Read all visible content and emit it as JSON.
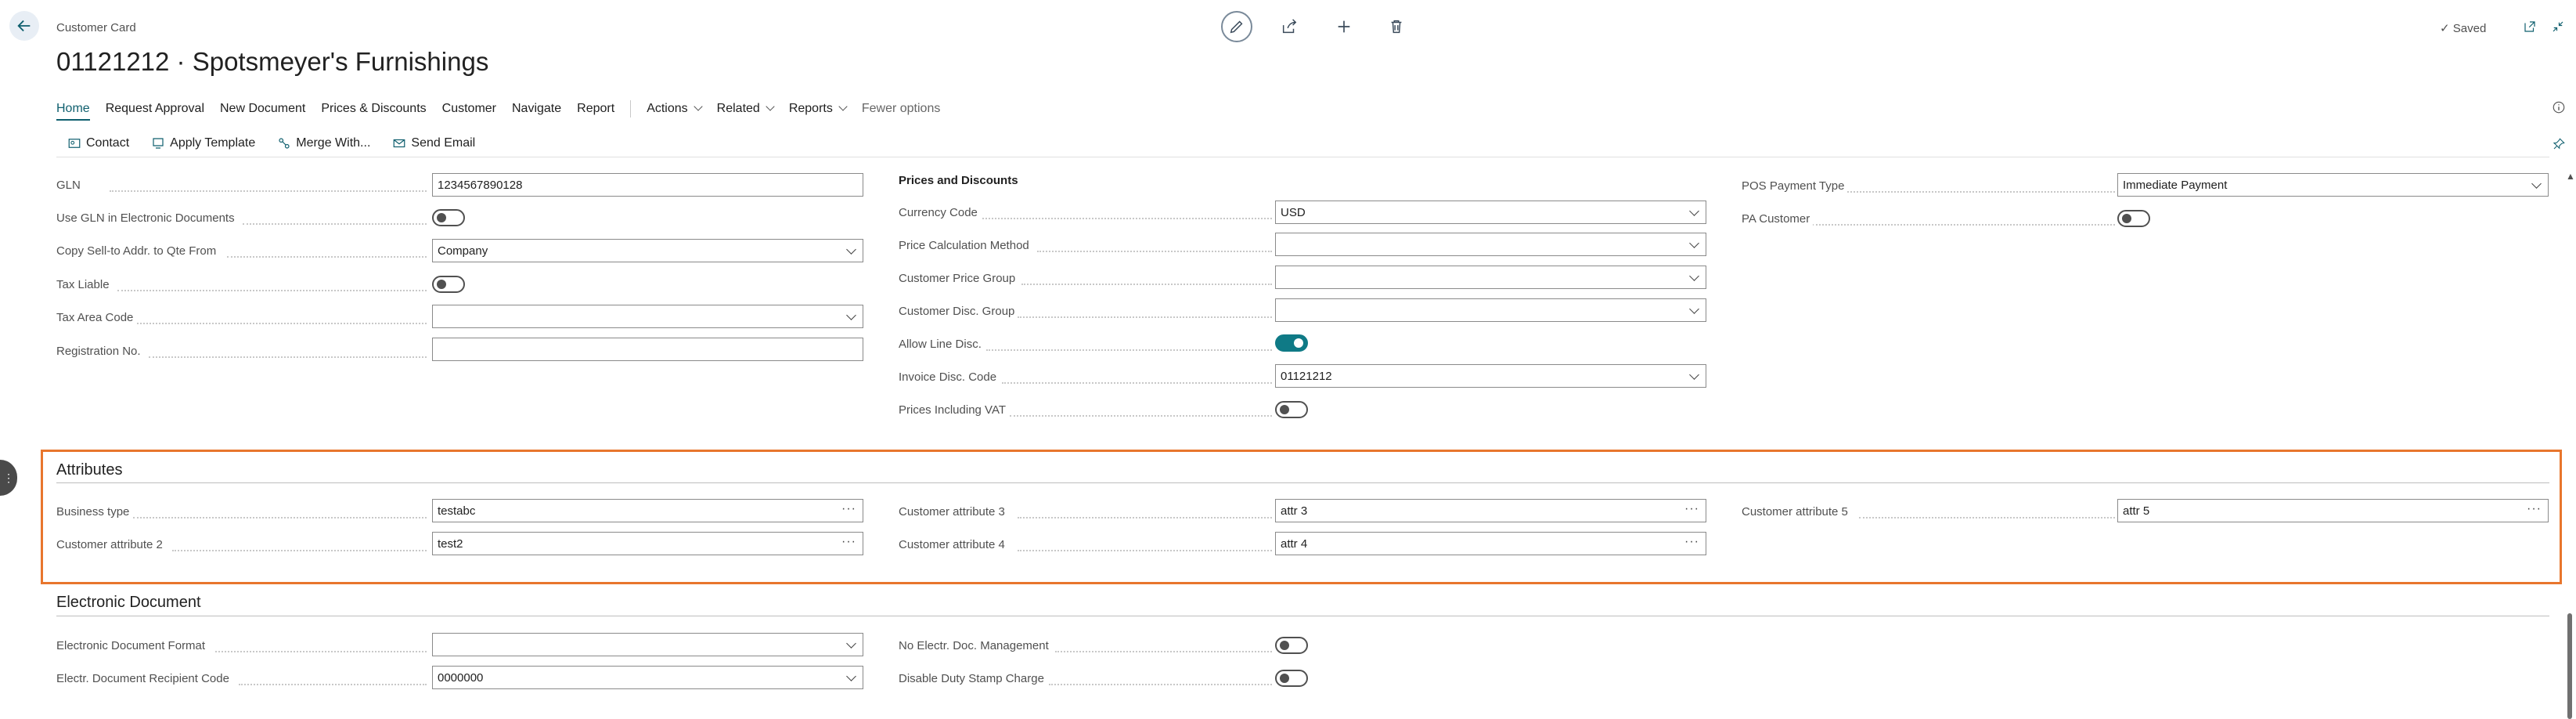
{
  "header": {
    "breadcrumb": "Customer Card",
    "title": "01121212 · Spotsmeyer's Furnishings",
    "saved_label": "Saved"
  },
  "nav": {
    "items": [
      "Home",
      "Request Approval",
      "New Document",
      "Prices & Discounts",
      "Customer",
      "Navigate",
      "Report"
    ],
    "dropdowns": [
      "Actions",
      "Related",
      "Reports"
    ],
    "fewer": "Fewer options"
  },
  "actions": [
    "Contact",
    "Apply Template",
    "Merge With...",
    "Send Email"
  ],
  "general": {
    "gln_label": "GLN",
    "gln_value": "1234567890128",
    "use_gln_label": "Use GLN in Electronic Documents",
    "copy_label": "Copy Sell-to Addr. to Qte From",
    "copy_value": "Company",
    "tax_liable_label": "Tax Liable",
    "tax_area_label": "Tax Area Code",
    "tax_area_value": "",
    "reg_label": "Registration No.",
    "reg_value": ""
  },
  "prices": {
    "heading": "Prices and Discounts",
    "currency_label": "Currency Code",
    "currency_value": "USD",
    "price_calc_label": "Price Calculation Method",
    "price_calc_value": "",
    "price_group_label": "Customer Price Group",
    "price_group_value": "",
    "disc_group_label": "Customer Disc. Group",
    "disc_group_value": "",
    "allow_line_label": "Allow Line Disc.",
    "allow_line_on": true,
    "invoice_disc_label": "Invoice Disc. Code",
    "invoice_disc_value": "01121212",
    "prices_vat_label": "Prices Including VAT"
  },
  "pos": {
    "payment_type_label": "POS Payment Type",
    "payment_type_value": "Immediate Payment",
    "pa_customer_label": "PA Customer"
  },
  "attributes": {
    "heading": "Attributes",
    "business_type_label": "Business type",
    "business_type_value": "testabc",
    "attr2_label": "Customer attribute 2",
    "attr2_value": "test2",
    "attr3_label": "Customer attribute 3",
    "attr3_value": "attr 3",
    "attr4_label": "Customer attribute 4",
    "attr4_value": "attr 4",
    "attr5_label": "Customer attribute 5",
    "attr5_value": "attr 5"
  },
  "edoc": {
    "heading": "Electronic Document",
    "format_label": "Electronic Document Format",
    "format_value": "",
    "recipient_label": "Electr. Document Recipient Code",
    "recipient_value": "0000000",
    "no_mgmt_label": "No Electr. Doc. Management",
    "duty_label": "Disable Duty Stamp Charge"
  },
  "colors": {
    "accent": "#0f7a86",
    "highlight": "#e8762d"
  }
}
